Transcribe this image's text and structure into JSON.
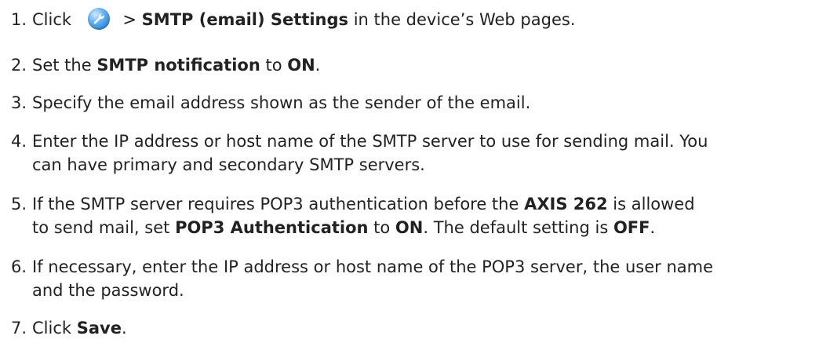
{
  "steps": [
    {
      "num": "1.",
      "parts": [
        "Click ",
        "",
        " > ",
        "SMTP (email) Settings",
        " in the device’s Web pages."
      ]
    },
    {
      "num": "2.",
      "parts": [
        "Set the ",
        "SMTP notification",
        " to ",
        "ON",
        "."
      ]
    },
    {
      "num": "3.",
      "parts": [
        "Specify the email address shown as the sender of the email."
      ]
    },
    {
      "num": "4.",
      "line1": "Enter the IP address or host name of the SMTP server to use for sending mail. You",
      "line2": "can have primary and secondary SMTP servers."
    },
    {
      "num": "5.",
      "parts": [
        "If the SMTP server requires POP3 authentication before the ",
        "AXIS 262",
        " is allowed"
      ],
      "parts2": [
        "to send mail, set ",
        "POP3 Authentication",
        " to ",
        "ON",
        ". The default setting is ",
        "OFF",
        "."
      ]
    },
    {
      "num": "6.",
      "line1": "If necessary, enter the IP address or host name of the POP3 server, the user name",
      "line2": "and the password."
    },
    {
      "num": "7.",
      "parts": [
        "Click ",
        "Save",
        "."
      ]
    }
  ],
  "icon": "wrench-settings-icon",
  "colors": {
    "text": "#222222",
    "icon_blue": "#2f86d9"
  }
}
